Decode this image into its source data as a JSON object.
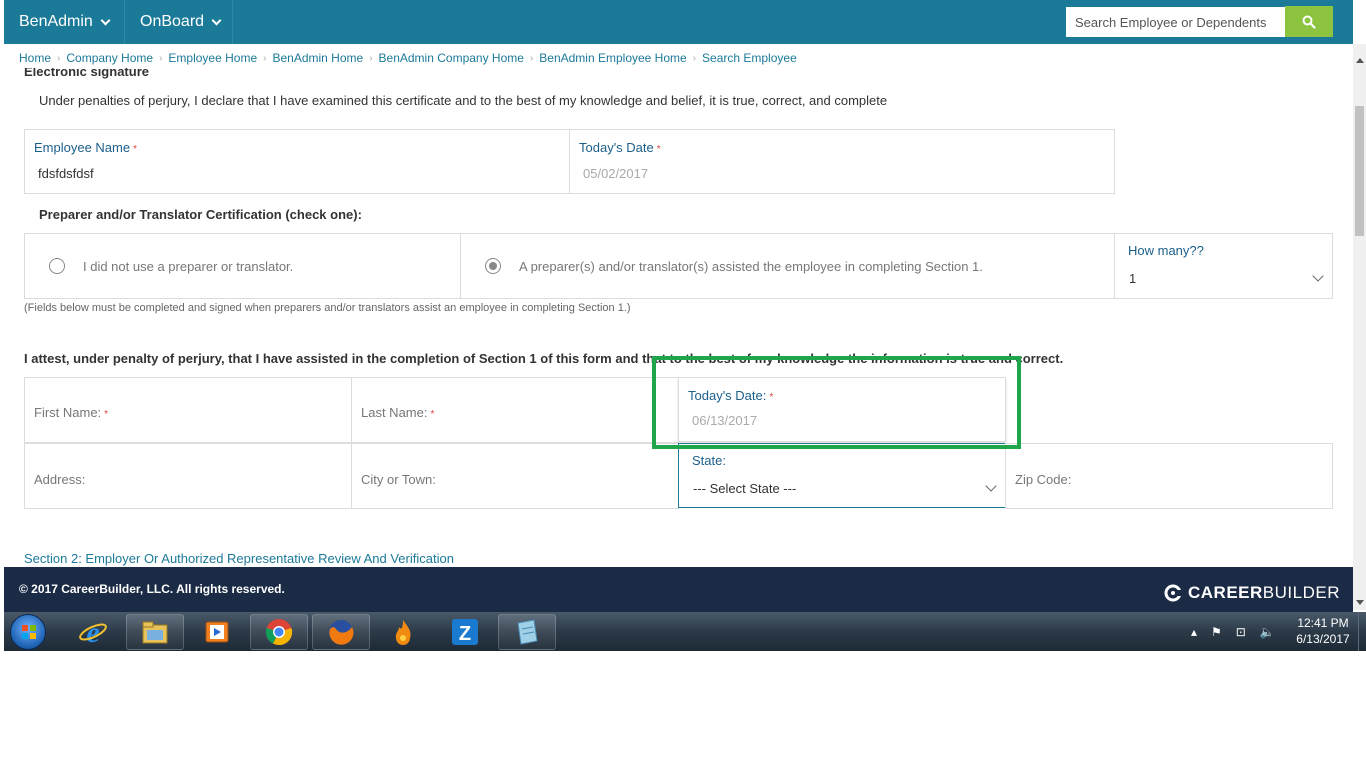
{
  "nav": {
    "menu1": "BenAdmin",
    "menu2": "OnBoard",
    "search_placeholder": "Search Employee or Dependents"
  },
  "breadcrumb": [
    "Home",
    "Company Home",
    "Employee Home",
    "BenAdmin Home",
    "BenAdmin Company Home",
    "BenAdmin Employee Home",
    "Search Employee"
  ],
  "form": {
    "cut_heading": "Electronic signature",
    "declaration": "Under penalties of perjury, I declare that I have examined this certificate and to the best of my knowledge and belief, it is true, correct, and complete",
    "employee_name_label": "Employee Name",
    "employee_name_value": "fdsfdsfdsf",
    "todays_date_label": "Today's Date",
    "todays_date_value": "05/02/2017",
    "preparer_heading": "Preparer and/or Translator Certification (check one):",
    "radio_no_preparer": "I did not use a preparer or translator.",
    "radio_preparer": "A preparer(s) and/or translator(s) assisted the employee in completing Section 1.",
    "how_many_label": "How many??",
    "how_many_value": "1",
    "fields_note": "(Fields below must be completed and signed when preparers and/or translators assist an employee in completing Section 1.)",
    "attest": "I attest, under penalty of perjury, that I have assisted in the completion of Section 1 of this form and that to the best of my knowledge the information is true and correct.",
    "first_name_label": "First Name:",
    "last_name_label": "Last Name:",
    "prep_date_label": "Today's Date:",
    "prep_date_value": "06/13/2017",
    "address_label": "Address:",
    "city_label": "City or Town:",
    "state_label": "State:",
    "state_value": "--- Select State ---",
    "zip_label": "Zip Code:",
    "section2_link": "Section 2: Employer Or Authorized Representative Review And Verification"
  },
  "footer": {
    "copyright": "© 2017 CareerBuilder, LLC. All rights reserved.",
    "logo_bold": "CAREER",
    "logo_light": "BUILDER"
  },
  "taskbar": {
    "time": "12:41 PM",
    "date": "6/13/2017"
  },
  "colors": {
    "nav": "#1c7a99",
    "search_button": "#8cc43f",
    "footer": "#1b2a45",
    "highlight": "#1fa64a",
    "label_blue": "#1c5f8a",
    "required": "#e04040"
  }
}
